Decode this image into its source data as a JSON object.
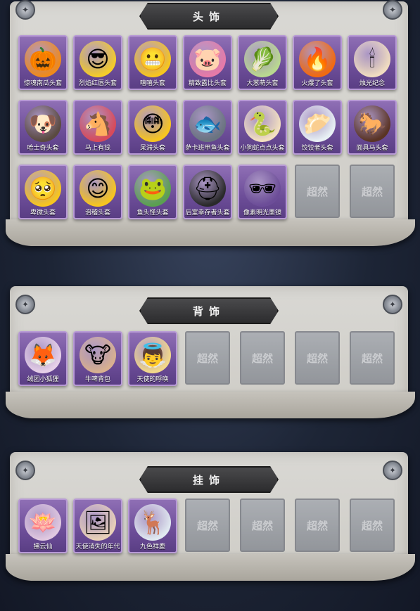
{
  "sections": [
    {
      "title": "头饰",
      "items": [
        {
          "label": "惊魂南瓜头套",
          "icon": "pumpkin-mask-icon",
          "glyph": "🎃",
          "bg": "#f08a1c"
        },
        {
          "label": "烈焰红唇头套",
          "icon": "pikachu-mask-icon",
          "glyph": "😎",
          "bg": "#f4cc2a"
        },
        {
          "label": "嘻嘻头套",
          "icon": "grin-emoji-mask-icon",
          "glyph": "😬",
          "bg": "#f7c520"
        },
        {
          "label": "精致露比头套",
          "icon": "pink-bird-mask-icon",
          "glyph": "🐷",
          "bg": "#e77aa8"
        },
        {
          "label": "大葱萌头套",
          "icon": "scallion-mask-icon",
          "glyph": "🥬",
          "bg": "#b9d890"
        },
        {
          "label": "火爆了头套",
          "icon": "fire-mask-icon",
          "glyph": "🔥",
          "bg": "#f26a10"
        },
        {
          "label": "烛光纪念",
          "icon": "candle-mask-icon",
          "glyph": "🕯",
          "bg": "#f0dcc0"
        },
        {
          "label": "哈士奇头套",
          "icon": "husky-mask-icon",
          "glyph": "🐶",
          "bg": "#5a4a40"
        },
        {
          "label": "马上有钱",
          "icon": "pink-horse-hat-icon",
          "glyph": "🐴",
          "bg": "#d84a5a"
        },
        {
          "label": "呆滞头套",
          "icon": "dazed-emoji-mask-icon",
          "glyph": "😳",
          "bg": "#f7c520"
        },
        {
          "label": "萨卡班甲鱼头套",
          "icon": "fish-mask-icon",
          "glyph": "🐟",
          "bg": "#6a7480"
        },
        {
          "label": "小狗蛇点点头套",
          "icon": "puppy-snake-mask-icon",
          "glyph": "🐍",
          "bg": "#f3e0c0"
        },
        {
          "label": "饺饺者头套",
          "icon": "dumpling-mask-icon",
          "glyph": "🥟",
          "bg": "#e8f0f4"
        },
        {
          "label": "面具马头套",
          "icon": "horse-head-mask-icon",
          "glyph": "🐎",
          "bg": "#5a3424"
        },
        {
          "label": "卑微头套",
          "icon": "humble-emoji-mask-icon",
          "glyph": "🥺",
          "bg": "#f7c520"
        },
        {
          "label": "滑稽头套",
          "icon": "funny-emoji-mask-icon",
          "glyph": "😊",
          "bg": "#f7c520"
        },
        {
          "label": "鱼头怪头套",
          "icon": "fish-monster-mask-icon",
          "glyph": "🐸",
          "bg": "#5aa050"
        },
        {
          "label": "后室幸存者头套",
          "icon": "gas-mask-helmet-icon",
          "glyph": "⛑",
          "bg": "#2a2a2a"
        },
        {
          "label": "像素明光墨镜",
          "icon": "pixel-sunglasses-icon",
          "glyph": "🕶",
          "bg": "#6c4d98"
        },
        {
          "empty": true,
          "placeholder": "超然"
        },
        {
          "empty": true,
          "placeholder": "超然"
        }
      ]
    },
    {
      "title": "背饰",
      "items": [
        {
          "label": "绒团小狐狸",
          "icon": "fox-plush-icon",
          "glyph": "🦊",
          "bg": "#e6d0e8"
        },
        {
          "label": "牛啤背包",
          "icon": "cow-beer-backpack-icon",
          "glyph": "🐮",
          "bg": "#d8b090"
        },
        {
          "label": "天使的呼唤",
          "icon": "angel-doll-icon",
          "glyph": "👼",
          "bg": "#f2d88a"
        },
        {
          "empty": true,
          "placeholder": "超然"
        },
        {
          "empty": true,
          "placeholder": "超然"
        },
        {
          "empty": true,
          "placeholder": "超然"
        },
        {
          "empty": true,
          "placeholder": "超然"
        }
      ]
    },
    {
      "title": "挂饰",
      "items": [
        {
          "label": "拂云仙",
          "icon": "cloud-fairy-charm-icon",
          "glyph": "🪷",
          "bg": "#e0c8e0"
        },
        {
          "label": "天使消失的年代",
          "icon": "angel-portrait-charm-icon",
          "glyph": "🖼",
          "bg": "#e8d0b8"
        },
        {
          "label": "九色祥鹿",
          "icon": "nine-color-deer-charm-icon",
          "glyph": "🦌",
          "bg": "#e0e8f0"
        },
        {
          "empty": true,
          "placeholder": "超然"
        },
        {
          "empty": true,
          "placeholder": "超然"
        },
        {
          "empty": true,
          "placeholder": "超然"
        },
        {
          "empty": true,
          "placeholder": "超然"
        }
      ]
    }
  ]
}
